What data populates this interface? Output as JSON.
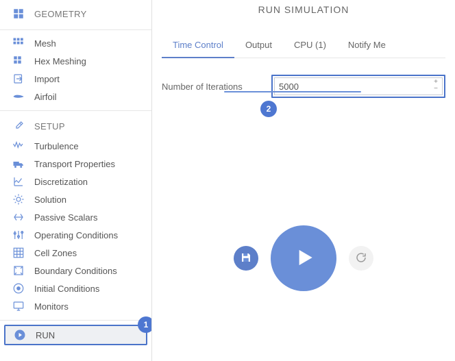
{
  "header": {
    "title": "RUN SIMULATION"
  },
  "tabs": {
    "time_control": "Time Control",
    "output": "Output",
    "cpu": "CPU  (1)",
    "notify": "Notify Me"
  },
  "field": {
    "iterations_label": "Number of Iterations",
    "iterations_value": "5000"
  },
  "sidebar": {
    "geometry": {
      "label": "GEOMETRY"
    },
    "geometry_items": {
      "mesh": "Mesh",
      "hex": "Hex Meshing",
      "import": "Import",
      "airfoil": "Airfoil"
    },
    "setup": {
      "label": "SETUP"
    },
    "setup_items": {
      "turb": "Turbulence",
      "transport": "Transport Properties",
      "disc": "Discretization",
      "solution": "Solution",
      "passive": "Passive Scalars",
      "oper": "Operating Conditions",
      "cell": "Cell Zones",
      "bc": "Boundary Conditions",
      "ic": "Initial Conditions",
      "mon": "Monitors"
    },
    "run": {
      "label": "RUN"
    }
  },
  "annotations": {
    "one": "1",
    "two": "2"
  }
}
